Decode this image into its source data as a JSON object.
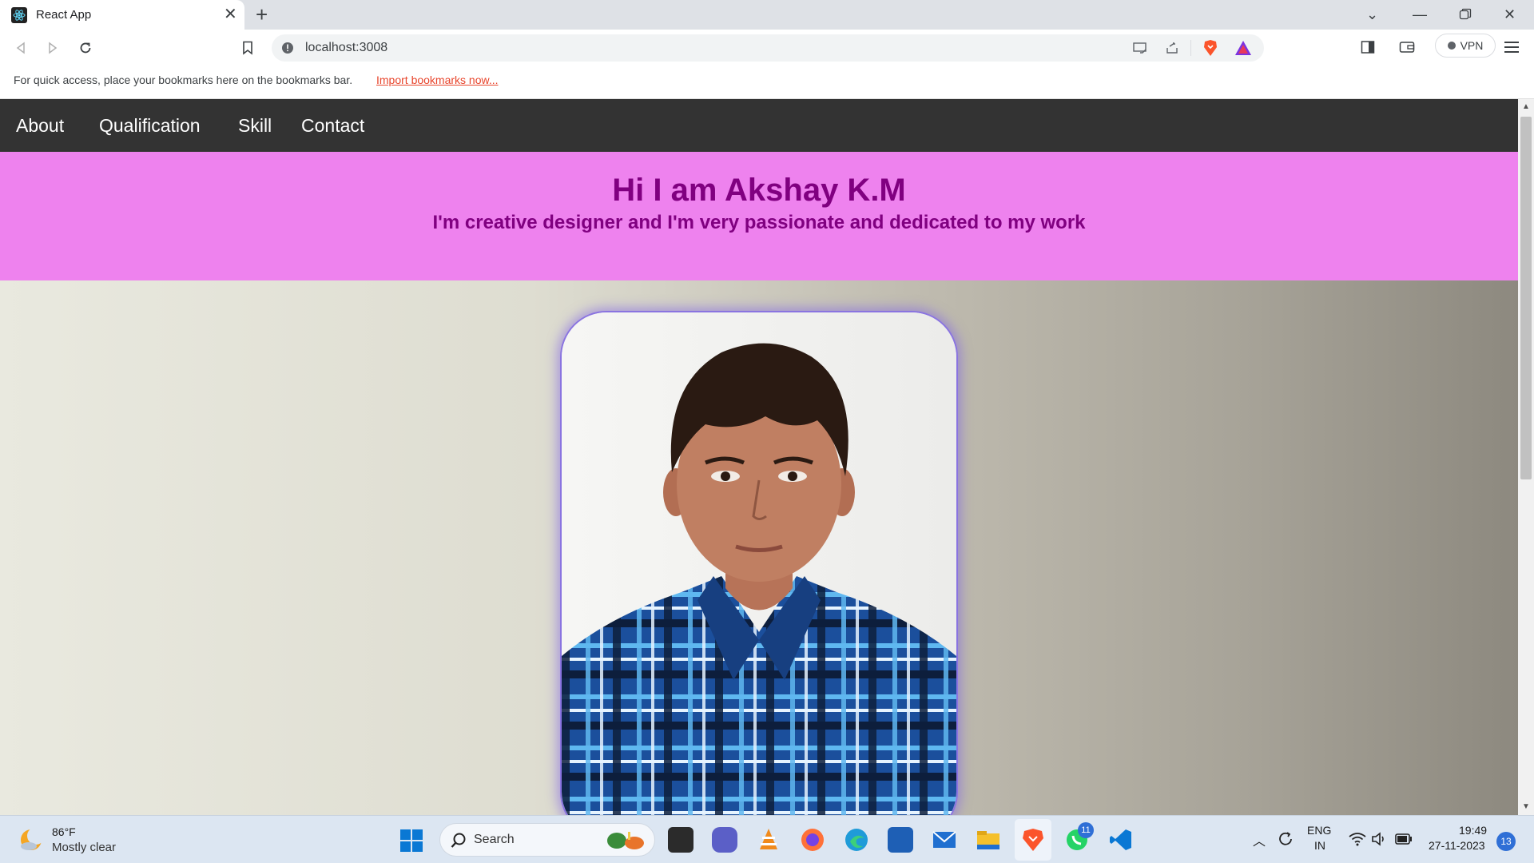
{
  "browser": {
    "tab_title": "React App",
    "url": "localhost:3008",
    "vpn_label": "VPN",
    "bookmarks_prompt": "For quick access, place your bookmarks here on the bookmarks bar.",
    "bookmarks_link": "Import bookmarks now..."
  },
  "page": {
    "nav": [
      "About",
      "Qualification",
      "Skill",
      "Contact"
    ],
    "hero_title": "Hi I am Akshay K.M",
    "hero_subtitle": "I'm creative designer and I'm very passionate and dedicated to my work",
    "colors": {
      "navbar": "#333333",
      "hero_bg": "#ee82ee",
      "hero_text": "#800080"
    }
  },
  "taskbar": {
    "weather_temp": "86°F",
    "weather_desc": "Mostly clear",
    "search_label": "Search",
    "whatsapp_badge": "11",
    "lang_top": "ENG",
    "lang_bottom": "IN",
    "time": "19:49",
    "date": "27-11-2023",
    "notification_count": "13"
  }
}
